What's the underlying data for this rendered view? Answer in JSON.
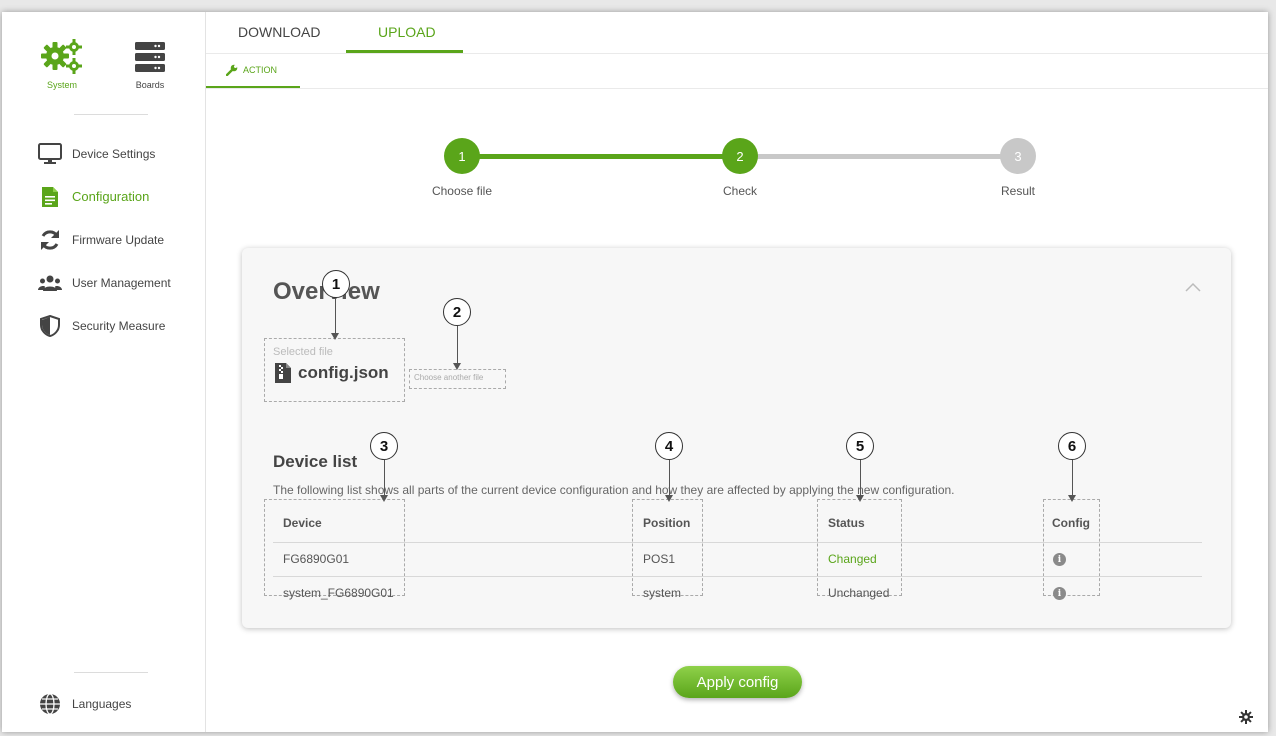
{
  "sidebar": {
    "top": {
      "system_label": "System",
      "boards_label": "Boards"
    },
    "items": [
      {
        "label": "Device Settings",
        "icon": "monitor-icon"
      },
      {
        "label": "Configuration",
        "icon": "document-icon",
        "active": true
      },
      {
        "label": "Firmware Update",
        "icon": "refresh-icon"
      },
      {
        "label": "User Management",
        "icon": "users-icon"
      },
      {
        "label": "Security Measure",
        "icon": "shield-icon"
      }
    ],
    "languages_label": "Languages"
  },
  "tabs": {
    "download_label": "DOWNLOAD",
    "upload_label": "UPLOAD",
    "action_label": "ACTION"
  },
  "stepper": {
    "steps": [
      {
        "number": "1",
        "label": "Choose file"
      },
      {
        "number": "2",
        "label": "Check"
      },
      {
        "number": "3",
        "label": "Result"
      }
    ]
  },
  "overview": {
    "title": "Overview",
    "selected_file_label": "Selected file",
    "file_name": "config.json",
    "choose_another_label": "Choose another file",
    "device_list": {
      "title": "Device list",
      "description": "The following list shows all parts of the current device configuration and how they are affected by applying the new configuration.",
      "columns": [
        "Device",
        "Position",
        "Status",
        "Config"
      ],
      "rows": [
        {
          "device": "FG6890G01",
          "position": "POS1",
          "status": "Changed"
        },
        {
          "device": "system_FG6890G01",
          "position": "system",
          "status": "Unchanged"
        }
      ]
    }
  },
  "callouts": [
    "1",
    "2",
    "3",
    "4",
    "5",
    "6"
  ],
  "apply_label": "Apply config",
  "colors": {
    "accent": "#5aa51a",
    "inactive_step": "#c8c8c8"
  }
}
